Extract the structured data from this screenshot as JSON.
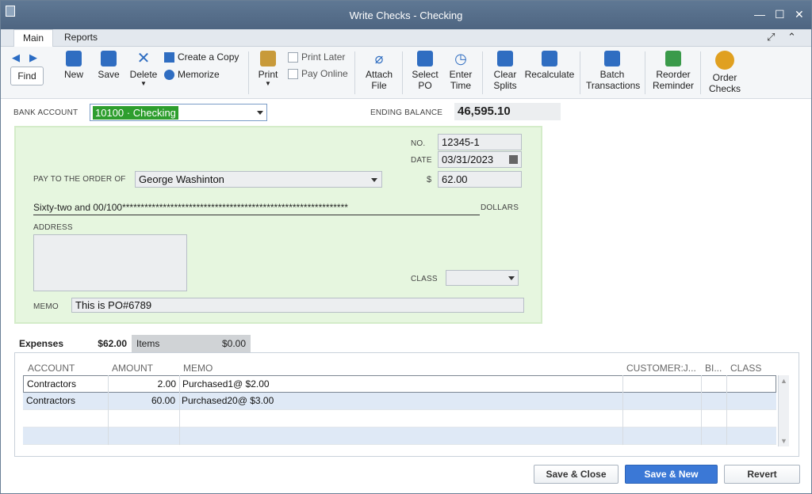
{
  "window": {
    "title": "Write Checks - Checking",
    "minimize_glyph": "—",
    "maximize_glyph": "☐",
    "close_glyph": "✕"
  },
  "top_tabs": [
    {
      "label": "Main"
    },
    {
      "label": "Reports"
    }
  ],
  "ribbon": {
    "find": "Find",
    "new": "New",
    "save": "Save",
    "delete": "Delete",
    "create_copy": "Create a Copy",
    "memorize": "Memorize",
    "print": "Print",
    "print_later": "Print Later",
    "pay_online": "Pay Online",
    "attach_file": [
      "Attach",
      "File"
    ],
    "select_po": [
      "Select",
      "PO"
    ],
    "enter_time": [
      "Enter",
      "Time"
    ],
    "clear_splits": [
      "Clear",
      "Splits"
    ],
    "recalculate": "Recalculate",
    "batch_transactions": [
      "Batch",
      "Transactions"
    ],
    "reorder_reminder": [
      "Reorder",
      "Reminder"
    ],
    "order_checks": [
      "Order",
      "Checks"
    ]
  },
  "form": {
    "bank_account_label": "BANK ACCOUNT",
    "bank_account_value": "10100 · Checking",
    "ending_balance_label": "ENDING BALANCE",
    "ending_balance_value": "46,595.10",
    "no_label": "NO.",
    "no_value": "12345-1",
    "date_label": "DATE",
    "date_value": "03/31/2023",
    "pay_to_label": "PAY TO THE ORDER OF",
    "pay_to_value": "George Washinton",
    "dollar_sign": "$",
    "amount_value": "62.00",
    "amount_words": "Sixty-two and 00/100*************************************************************",
    "dollars_label": "DOLLARS",
    "address_label": "ADDRESS",
    "class_label": "CLASS",
    "memo_label": "MEMO",
    "memo_value": "This is PO#6789"
  },
  "subtabs": {
    "expenses_label": "Expenses",
    "expenses_total": "$62.00",
    "items_label": "Items",
    "items_total": "$0.00"
  },
  "grid": {
    "headers": [
      "ACCOUNT",
      "AMOUNT",
      "MEMO",
      "CUSTOMER:J...",
      "BI...",
      "CLASS"
    ],
    "rows": [
      {
        "account": "Contractors",
        "amount": "2.00",
        "memo": "Purchased1@ $2.00"
      },
      {
        "account": "Contractors",
        "amount": "60.00",
        "memo": "Purchased20@ $3.00"
      }
    ]
  },
  "footer": {
    "save_close": "Save & Close",
    "save_new": "Save & New",
    "revert": "Revert"
  },
  "colors": {
    "titlebar": "#56708c",
    "check_bg": "#e6f6df",
    "primary_button": "#3b78d6",
    "selection_green": "#2e9e2e"
  }
}
